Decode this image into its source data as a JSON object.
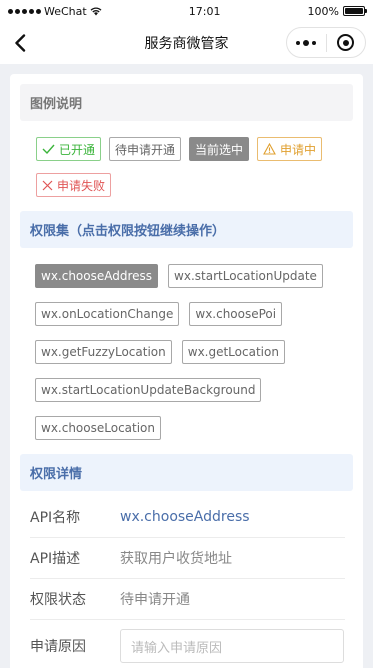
{
  "status_bar": {
    "carrier": "WeChat",
    "time": "17:01",
    "battery": "100%",
    "battery_level": 1.0
  },
  "nav": {
    "title": "服务商微管家"
  },
  "legend": {
    "title": "图例说明",
    "items": [
      {
        "label": "已开通",
        "kind": "ok",
        "icon": "check-icon"
      },
      {
        "label": "待申请开通",
        "kind": "pending"
      },
      {
        "label": "当前选中",
        "kind": "current"
      },
      {
        "label": "申请中",
        "kind": "applying",
        "icon": "warning-icon"
      },
      {
        "label": "申请失败",
        "kind": "failed",
        "icon": "cross-icon"
      }
    ]
  },
  "permissions": {
    "title": "权限集（点击权限按钮继续操作）",
    "items": [
      "wx.chooseAddress",
      "wx.startLocationUpdate",
      "wx.onLocationChange",
      "wx.choosePoi",
      "wx.getFuzzyLocation",
      "wx.getLocation",
      "wx.startLocationUpdateBackground",
      "wx.chooseLocation"
    ],
    "selected": "wx.chooseAddress"
  },
  "details": {
    "title": "权限详情",
    "api_name_label": "API名称",
    "api_name": "wx.chooseAddress",
    "api_desc_label": "API描述",
    "api_desc": "获取用户收货地址",
    "status_label": "权限状态",
    "status": "待申请开通",
    "reason_label": "申请原因",
    "reason_placeholder": "请输入申请原因"
  },
  "colors": {
    "link": "#4a6ea9",
    "ok": "#3bb43b",
    "applying": "#e0a030",
    "failed": "#e05555",
    "selected": "#8a8a8a"
  }
}
